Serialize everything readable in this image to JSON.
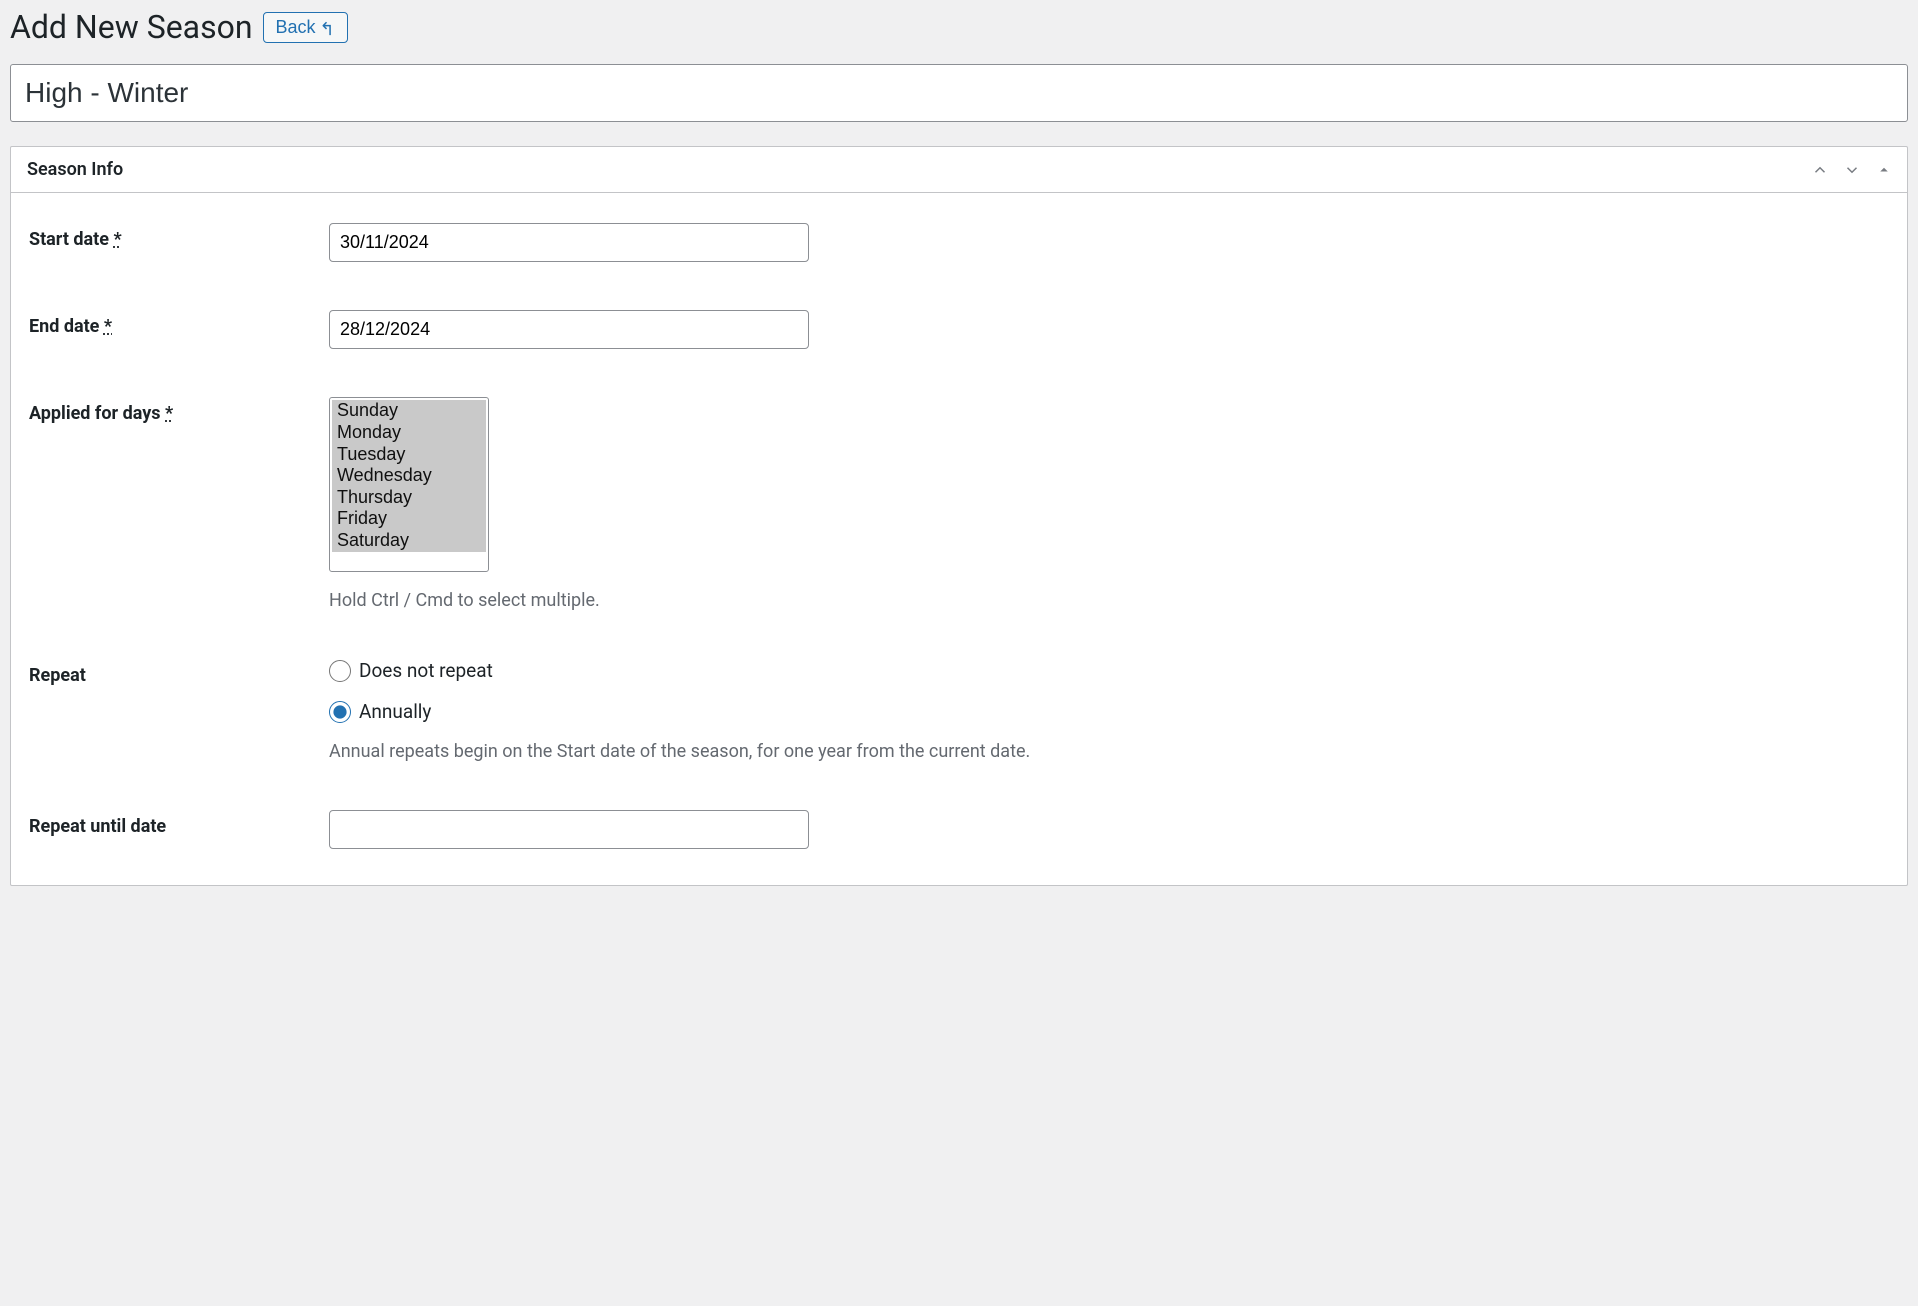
{
  "header": {
    "page_title": "Add New Season",
    "back_label": "Back",
    "title_value": "High - Winter",
    "title_placeholder": "Add title"
  },
  "postbox": {
    "title": "Season Info"
  },
  "fields": {
    "start_date": {
      "label": "Start date ",
      "required_mark": "*",
      "value": "30/11/2024"
    },
    "end_date": {
      "label": "End date ",
      "required_mark": "*",
      "value": "28/12/2024"
    },
    "days": {
      "label": "Applied for days ",
      "required_mark": "*",
      "options": [
        "Sunday",
        "Monday",
        "Tuesday",
        "Wednesday",
        "Thursday",
        "Friday",
        "Saturday"
      ],
      "help": "Hold Ctrl / Cmd to select multiple."
    },
    "repeat": {
      "label": "Repeat",
      "option_none": "Does not repeat",
      "option_annually": "Annually",
      "help": "Annual repeats begin on the Start date of the season, for one year from the current date."
    },
    "repeat_until": {
      "label": "Repeat until date",
      "value": ""
    }
  }
}
